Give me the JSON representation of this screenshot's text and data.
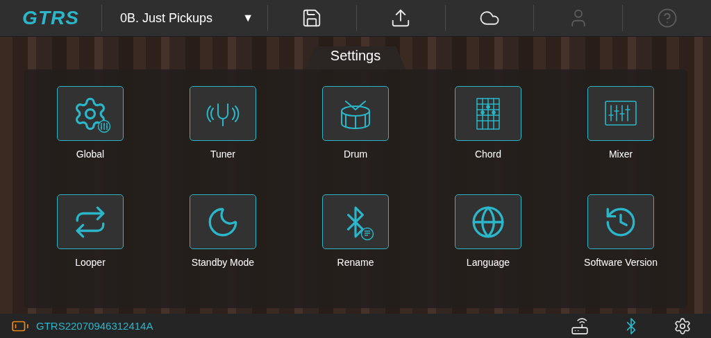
{
  "top_bar": {
    "logo": "GTRS",
    "preset": {
      "label": "0B. Just Pickups",
      "caret": "▼"
    },
    "tools": [
      {
        "disabled": false
      },
      {
        "disabled": false
      },
      {
        "disabled": false
      },
      {
        "disabled": true
      },
      {
        "disabled": true
      }
    ]
  },
  "settings": {
    "title": "Settings",
    "items": [
      {
        "label": "Global"
      },
      {
        "label": "Tuner"
      },
      {
        "label": "Drum"
      },
      {
        "label": "Chord"
      },
      {
        "label": "Mixer"
      },
      {
        "label": "Looper"
      },
      {
        "label": "Standby Mode"
      },
      {
        "label": "Rename"
      },
      {
        "label": "Language"
      },
      {
        "label": "Software Version"
      }
    ]
  },
  "status_bar": {
    "device": "GTRS22070946312414A",
    "bluetooth_on": true
  }
}
